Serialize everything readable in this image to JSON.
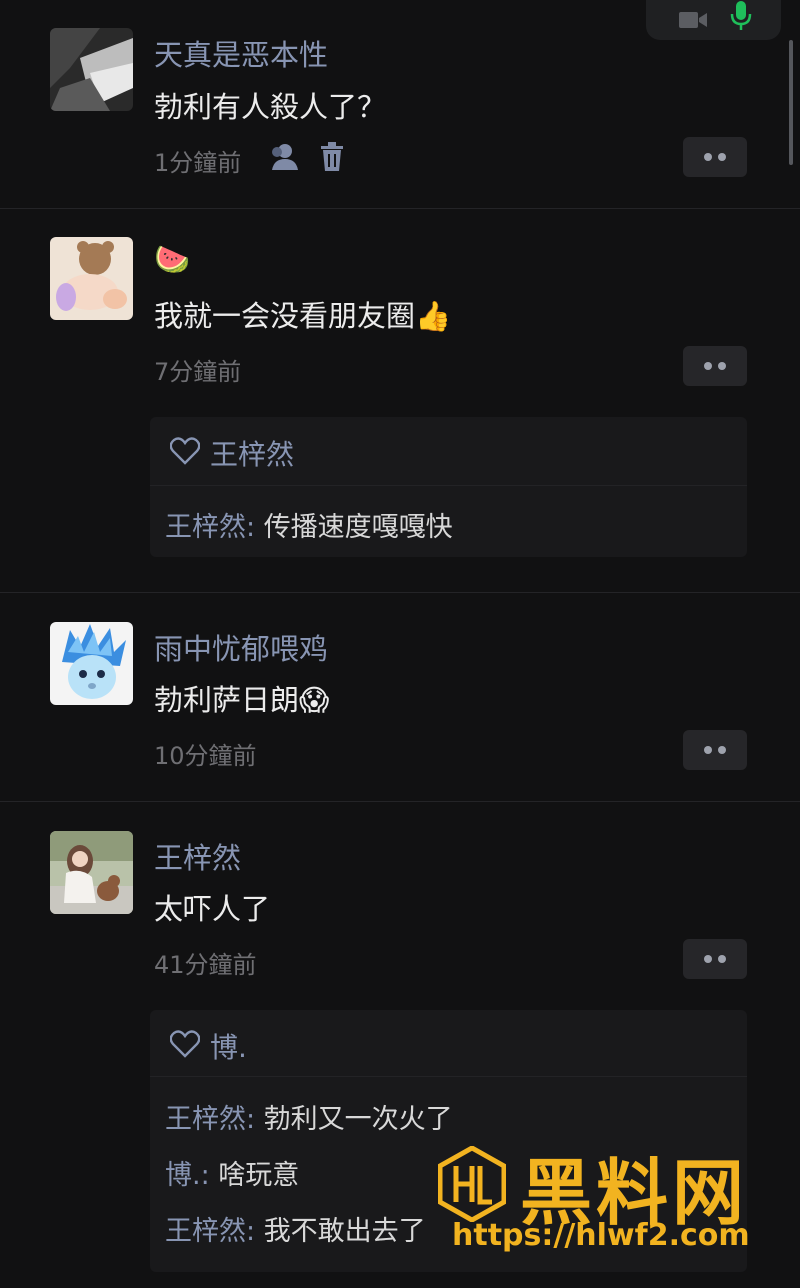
{
  "comments": [
    {
      "author": "天真是恶本性",
      "text": "勃利有人殺人了？",
      "time": "1分鐘前",
      "actions": [
        "person-icon",
        "trash-icon"
      ]
    },
    {
      "author": "🍉",
      "text": "我就一会没看朋友圈👍",
      "time": "7分鐘前",
      "likes": "王梓然",
      "replies": [
        {
          "name": "王梓然",
          "sep": ": ",
          "text": "传播速度嘎嘎快"
        }
      ]
    },
    {
      "author": "雨中忧郁喂鸡",
      "text": "勃利萨日朗😱",
      "time": "10分鐘前"
    },
    {
      "author": "王梓然",
      "text": "太吓人了",
      "time": "41分鐘前",
      "likes": "博.",
      "replies": [
        {
          "name": "王梓然",
          "sep": ": ",
          "text": "勃利又一次火了"
        },
        {
          "name": "博.",
          "sep": ": ",
          "text": "啥玩意"
        },
        {
          "name": "王梓然",
          "sep": ": ",
          "text": "我不敢出去了"
        }
      ]
    }
  ],
  "watermark": {
    "title": "黑料网",
    "url": "https://hlwf2.com"
  },
  "colors": {
    "background": "#111112",
    "name": "#8895b3",
    "mic": "#1fbf5b",
    "watermark": "#f2b320"
  }
}
